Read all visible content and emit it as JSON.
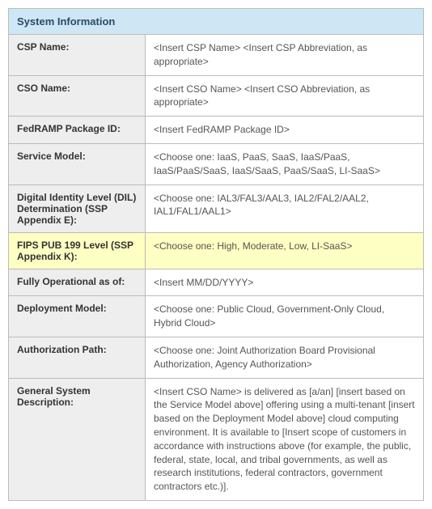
{
  "header": "System Information",
  "rows": [
    {
      "label": "CSP Name:",
      "value": "<Insert CSP Name> <Insert CSP Abbreviation, as appropriate>",
      "highlight": false
    },
    {
      "label": "CSO Name:",
      "value": "<Insert CSO Name> <Insert CSO Abbreviation, as appropriate>",
      "highlight": false
    },
    {
      "label": "FedRAMP Package ID:",
      "value": "<Insert FedRAMP Package ID>",
      "highlight": false
    },
    {
      "label": "Service Model:",
      "value": "<Choose one: IaaS, PaaS, SaaS, IaaS/PaaS, IaaS/PaaS/SaaS, IaaS/SaaS, PaaS/SaaS, LI-SaaS>",
      "highlight": false
    },
    {
      "label": "Digital Identity Level (DIL) Determination (SSP Appendix E):",
      "value": "<Choose one: IAL3/FAL3/AAL3, IAL2/FAL2/AAL2, IAL1/FAL1/AAL1>",
      "highlight": false
    },
    {
      "label": "FIPS PUB 199 Level (SSP Appendix K):",
      "value": "<Choose one: High, Moderate, Low, LI-SaaS>",
      "highlight": true
    },
    {
      "label": "Fully Operational as of:",
      "value": "<Insert MM/DD/YYYY>",
      "highlight": false
    },
    {
      "label": "Deployment Model:",
      "value": "<Choose one: Public Cloud, Government-Only Cloud, Hybrid Cloud>",
      "highlight": false
    },
    {
      "label": "Authorization Path:",
      "value": "<Choose one: Joint Authorization Board Provisional Authorization, Agency Authorization>",
      "highlight": false
    },
    {
      "label": "General System Description:",
      "value": "<Insert CSO Name> is delivered as [a/an] [insert based on the Service Model above] offering using a multi-tenant [insert based on the Deployment Model above] cloud computing environment. It is available to [Insert scope of customers in accordance with instructions above (for example, the public, federal, state, local, and tribal governments, as well as research institutions, federal contractors, government contractors etc.)].",
      "highlight": false
    }
  ]
}
